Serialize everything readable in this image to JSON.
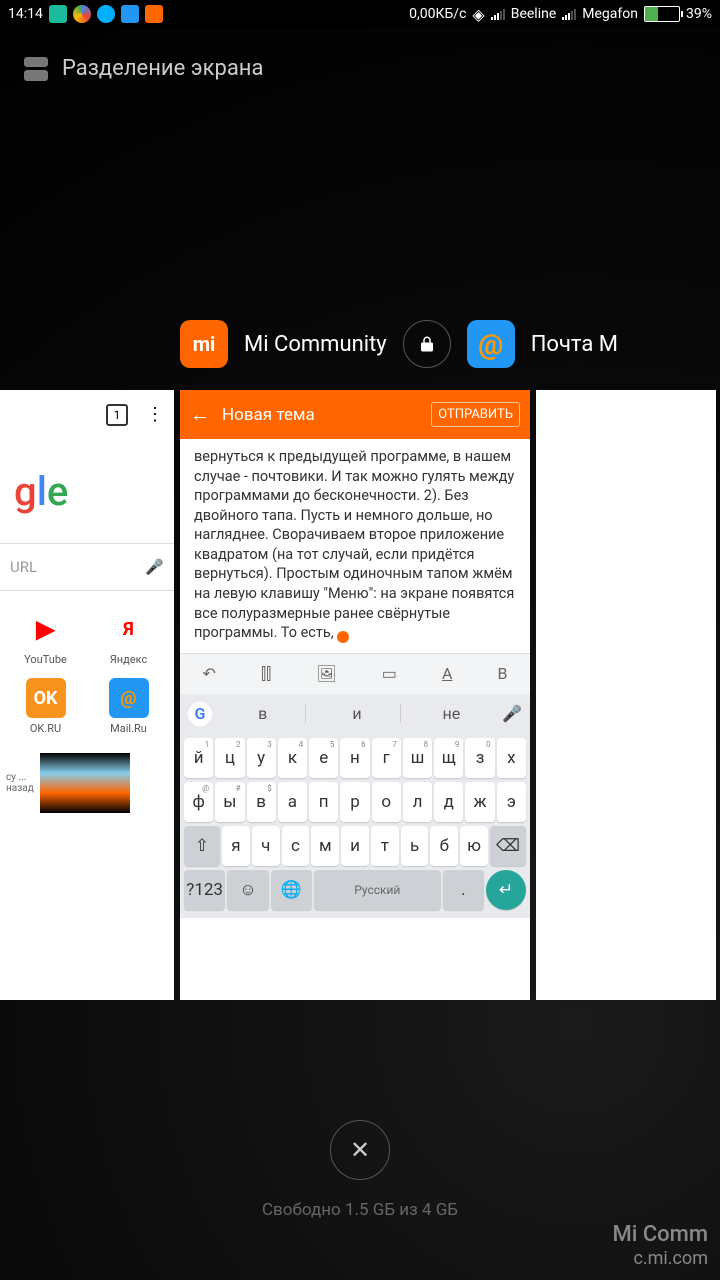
{
  "status": {
    "time": "14:14",
    "data_rate": "0,00КБ/с",
    "carrier1": "Beeline",
    "carrier2": "Megafon",
    "battery": "39%"
  },
  "split_screen_label": "Разделение экрана",
  "apps": {
    "mi_community": "Mi Community",
    "mail": "Почта M"
  },
  "chrome": {
    "tab_count": "1",
    "url_placeholder": "URL",
    "shortcuts": {
      "youtube": "YouTube",
      "yandex": "Яндекс",
      "okru": "OK.RU",
      "mailru": "Mail.Ru"
    },
    "news_snip": "су ...",
    "news_snip2": "назад"
  },
  "mi_post": {
    "header_title": "Новая тема",
    "send": "ОТПРАВИТЬ",
    "body": "вернуться к предыдущей программе, в нашем случае - почтовики. И так можно гулять между программами до бесконечности. 2). Без двойного тапа. Пусть и немного дольше, но нагляднее. Сворачиваем второе приложение квадратом (на тот случай, если придётся вернуться). Простым одиночным тапом жмём на левую клавишу \"Меню\": на экране появятся все полуразмерные ранее свёрнутые программы. То есть,"
  },
  "keyboard": {
    "suggest1": "в",
    "suggest2": "и",
    "suggest3": "не",
    "row1": [
      "й",
      "ц",
      "у",
      "к",
      "е",
      "н",
      "г",
      "ш",
      "щ",
      "з",
      "х"
    ],
    "row1_sup": [
      "1",
      "2",
      "3",
      "4",
      "5",
      "6",
      "7",
      "8",
      "9",
      "0",
      ""
    ],
    "row2": [
      "ф",
      "ы",
      "в",
      "а",
      "п",
      "р",
      "о",
      "л",
      "д",
      "ж",
      "э"
    ],
    "row2_sup": [
      "@",
      "#",
      "$",
      "",
      "",
      "",
      "",
      "",
      "",
      "",
      ""
    ],
    "row3": [
      "я",
      "ч",
      "с",
      "м",
      "и",
      "т",
      "ь",
      "б",
      "ю"
    ],
    "symkey": "?123",
    "lang": "Русский"
  },
  "free_memory": "Свободно 1.5 GБ из 4 GБ",
  "watermark": {
    "line1": "Mi Comm",
    "line2": "c.mi.com"
  }
}
